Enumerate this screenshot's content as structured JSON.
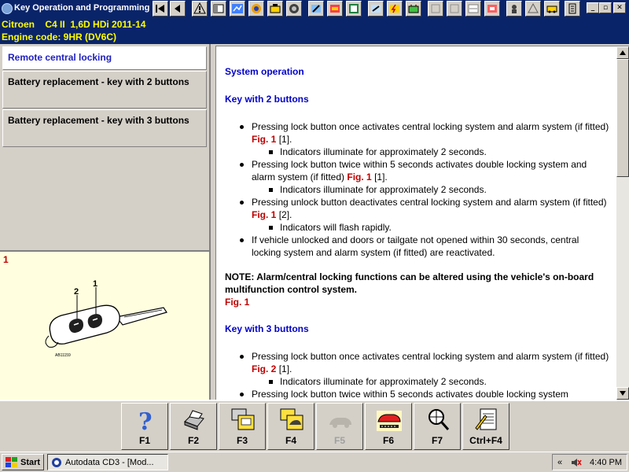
{
  "window": {
    "title": "Key Operation and Programming"
  },
  "vehicle": {
    "make": "Citroen",
    "model": "C4 II  1,6D HDi 2011-14",
    "engine_code": "Engine code: 9HR (DV6C)"
  },
  "nav": {
    "items": [
      {
        "label": "Remote central locking",
        "active": true
      },
      {
        "label": "Battery replacement - key with 2 buttons",
        "active": false
      },
      {
        "label": "Battery replacement - key with 3 buttons",
        "active": false
      }
    ]
  },
  "figure": {
    "number": "1",
    "callout_1": "1",
    "callout_2": "2",
    "ref": "AB11159"
  },
  "content": {
    "section_title": "System operation",
    "key2": {
      "heading": "Key with 2 buttons",
      "b1_text": "Pressing lock button once activates central locking system and alarm system (if fitted)",
      "b1_fig": "Fig. 1",
      "b1_ref": "[1].",
      "b1_sub": "Indicators illuminate for approximately 2 seconds.",
      "b2_text": "Pressing lock button twice within 5 seconds activates double locking system and alarm system (if fitted)",
      "b2_fig": "Fig. 1",
      "b2_ref": "[1].",
      "b2_sub": "Indicators illuminate for approximately 2 seconds.",
      "b3_text": "Pressing unlock button deactivates central locking system and alarm system (if fitted)",
      "b3_fig": "Fig. 1",
      "b3_ref": "[2].",
      "b3_sub": "Indicators will flash rapidly.",
      "b4_text": "If vehicle unlocked and doors or tailgate not opened within 30 seconds, central locking system and alarm system (if fitted) are reactivated."
    },
    "note": "NOTE: Alarm/central locking functions can be altered using the vehicle's on-board multifunction control system.",
    "note_fig": "Fig. 1",
    "key3": {
      "heading": "Key with 3 buttons",
      "b1_text": "Pressing lock button once activates central locking system and alarm system (if fitted)",
      "b1_fig": "Fig. 2",
      "b1_ref": "[1].",
      "b1_sub": "Indicators illuminate for approximately 2 seconds.",
      "b2_text": "Pressing lock button twice within 5 seconds activates double locking system"
    }
  },
  "fkeys": [
    {
      "label": "F1",
      "icon": "help-icon",
      "enabled": true
    },
    {
      "label": "F2",
      "icon": "printer-icon",
      "enabled": true
    },
    {
      "label": "F3",
      "icon": "images-icon",
      "enabled": true
    },
    {
      "label": "F4",
      "icon": "car-images-icon",
      "enabled": true
    },
    {
      "label": "F5",
      "icon": "car-icon",
      "enabled": false
    },
    {
      "label": "F6",
      "icon": "car-service-icon",
      "enabled": true
    },
    {
      "label": "F7",
      "icon": "search-zoom-icon",
      "enabled": true
    },
    {
      "label": "Ctrl+F4",
      "icon": "notes-icon",
      "enabled": true
    }
  ],
  "taskbar": {
    "start_label": "Start",
    "task_label": "Autodata CD3 - [Mod...",
    "tray_chevron": "«",
    "clock": "4:40 PM"
  },
  "colors": {
    "titlebar": "#0a246a",
    "vehicle_text": "#ffff00",
    "heading_blue": "#0000c8",
    "fig_red": "#c00000",
    "figure_bg": "#ffffe0"
  }
}
